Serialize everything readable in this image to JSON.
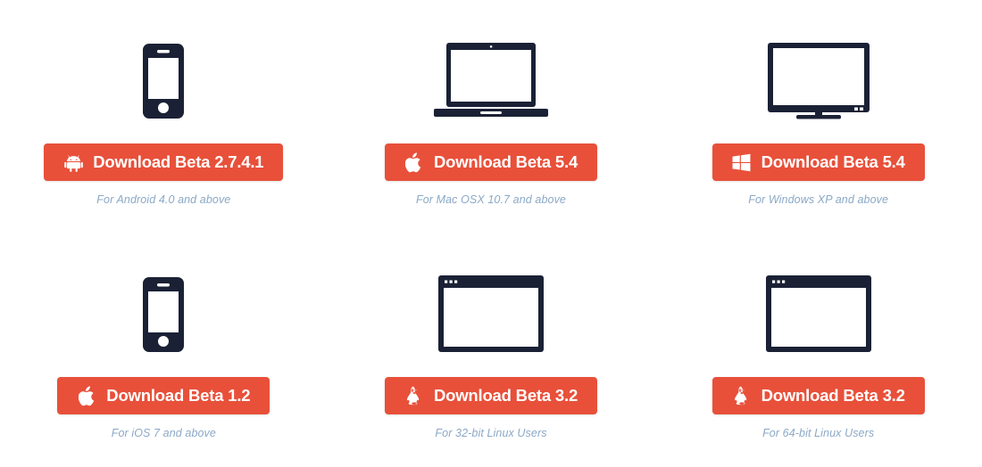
{
  "page": {
    "background_color": "#ffffff",
    "button_color": "#e8503a",
    "button_text_color": "#ffffff",
    "device_color": "#1b2135",
    "caption_color": "#8ba8c6"
  },
  "cards": [
    {
      "id": "android",
      "device_icon": "smartphone-icon",
      "logo_icon": "android-logo-icon",
      "button_label": "Download Beta 2.7.4.1",
      "caption": "For Android 4.0 and above"
    },
    {
      "id": "mac",
      "device_icon": "laptop-icon",
      "logo_icon": "apple-logo-icon",
      "button_label": "Download Beta 5.4",
      "caption": "For Mac OSX 10.7 and above"
    },
    {
      "id": "windows",
      "device_icon": "desktop-monitor-icon",
      "logo_icon": "windows-logo-icon",
      "button_label": "Download Beta 5.4",
      "caption": "For Windows XP and above"
    },
    {
      "id": "ios",
      "device_icon": "smartphone-icon",
      "logo_icon": "apple-logo-icon",
      "button_label": "Download Beta 1.2",
      "caption": "For iOS 7 and above"
    },
    {
      "id": "linux32",
      "device_icon": "window-frame-icon",
      "logo_icon": "linux-penguin-logo-icon",
      "button_label": "Download Beta 3.2",
      "caption": "For 32-bit Linux Users"
    },
    {
      "id": "linux64",
      "device_icon": "window-frame-icon",
      "logo_icon": "linux-penguin-logo-icon",
      "button_label": "Download Beta 3.2",
      "caption": "For 64-bit Linux Users"
    }
  ]
}
